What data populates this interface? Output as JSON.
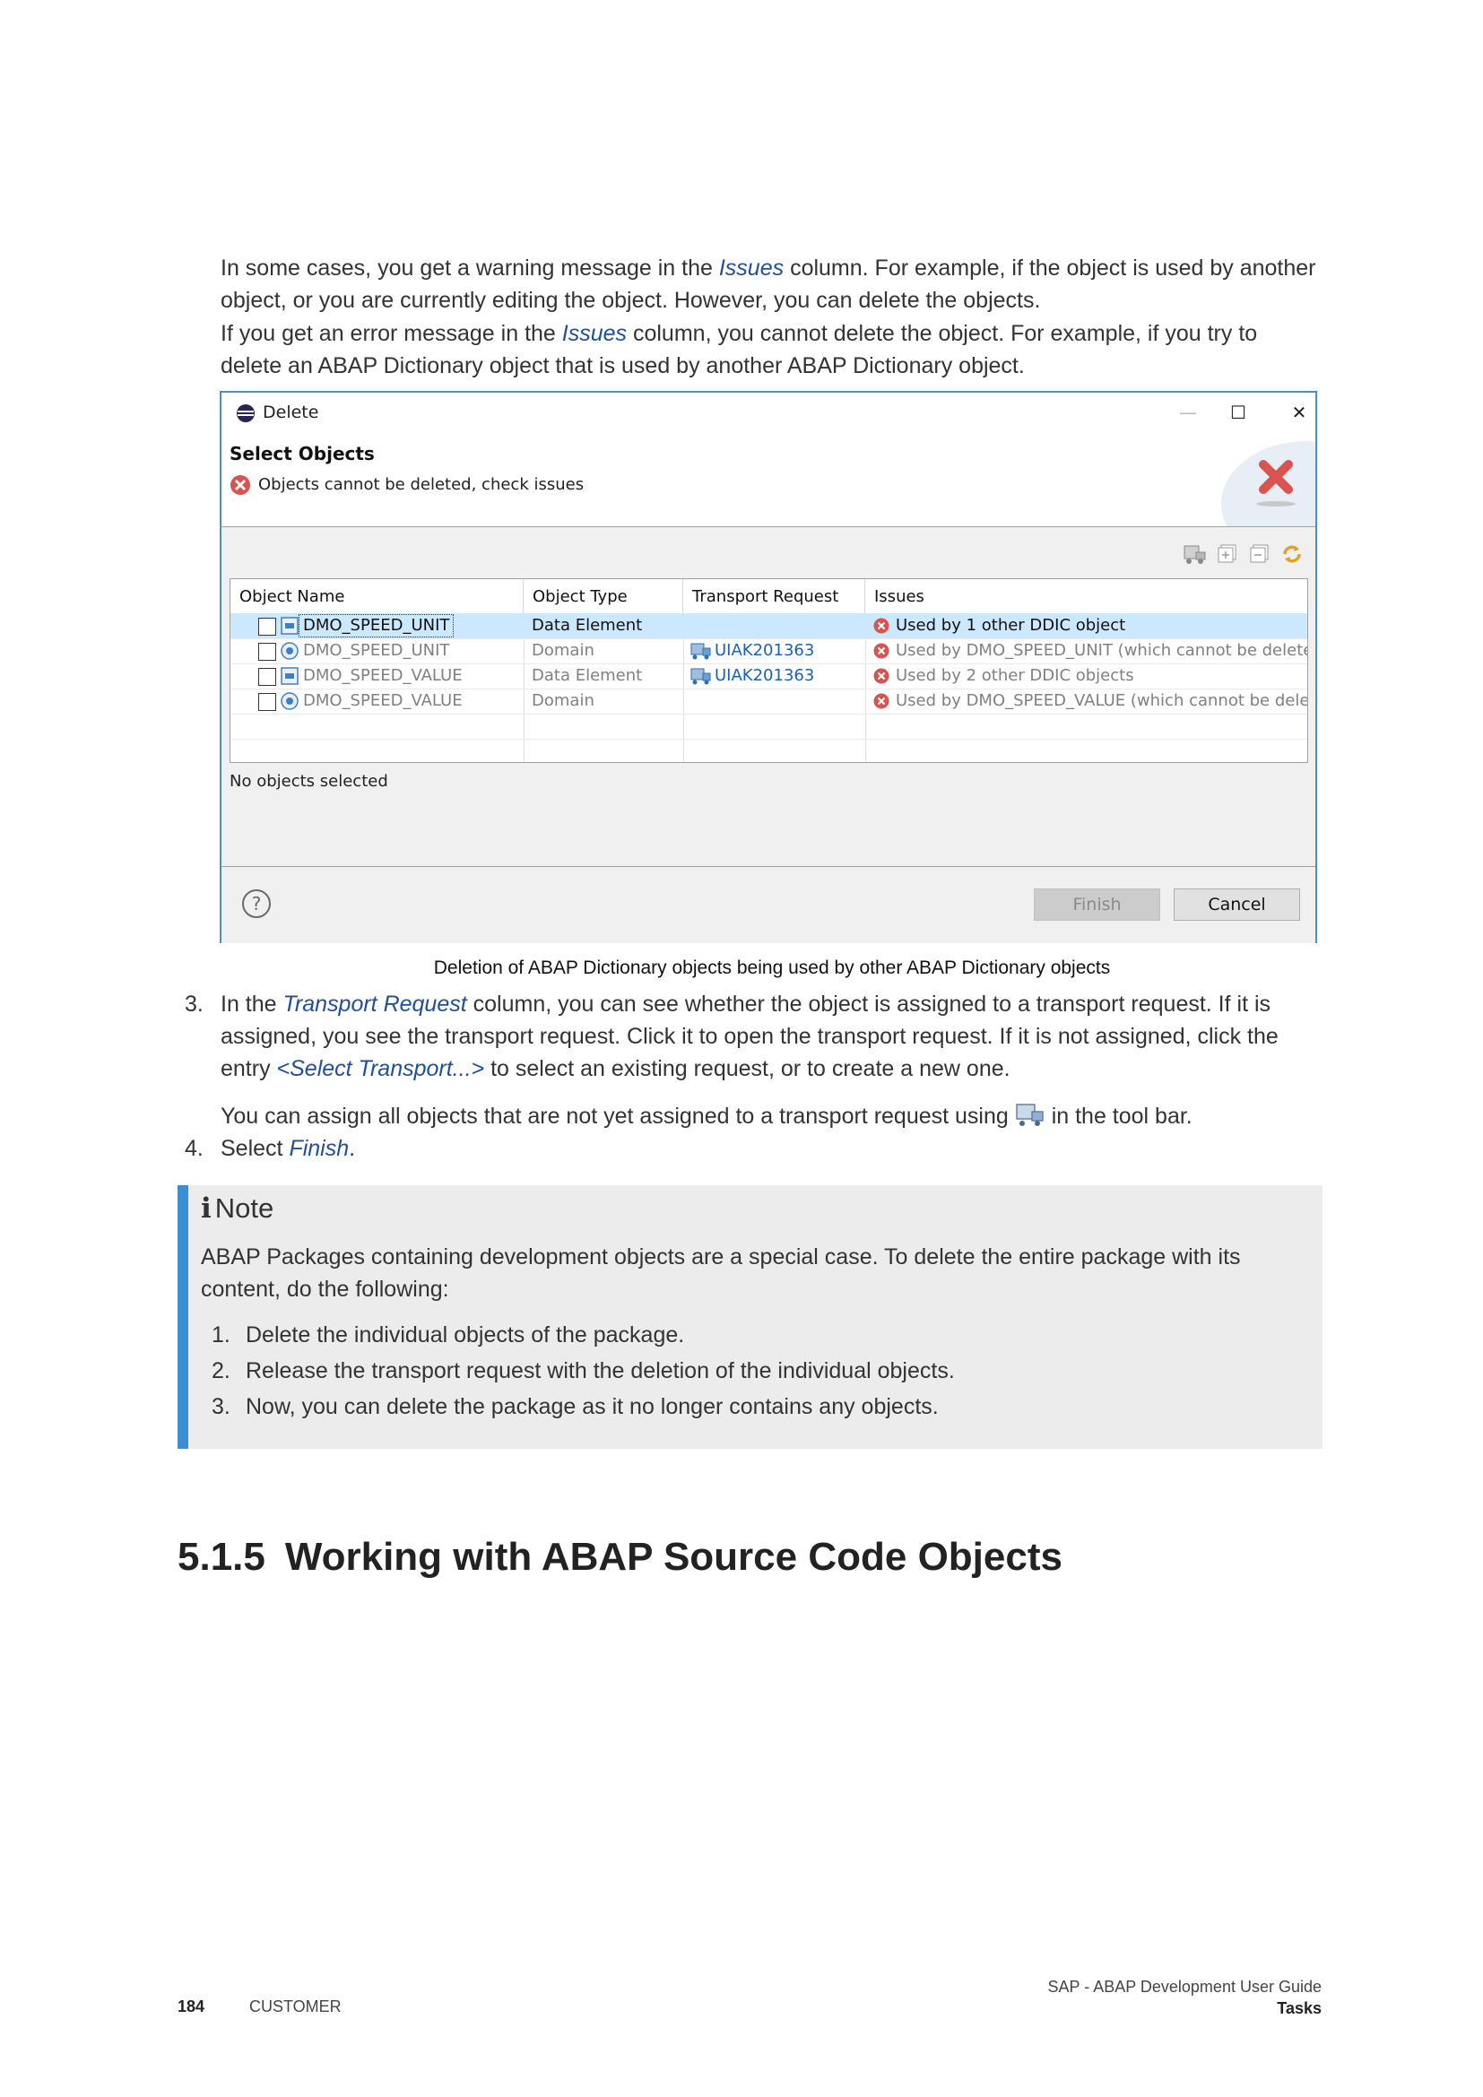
{
  "intro": {
    "line1_pre": "In some cases, you get a warning message in the ",
    "line1_link": "Issues",
    "line1_post": " column. For example, if the object is used by another object, or you are currently editing the object. However, you can delete the objects.",
    "line2_pre": "If you get an error message in the ",
    "line2_link": "Issues",
    "line2_post": " column, you cannot delete the object. For example, if you try to delete an ABAP Dictionary object that is used by another ABAP Dictionary object."
  },
  "dialog": {
    "title": "Delete",
    "minimize": "—",
    "maximize": "☐",
    "close": "✕",
    "header_title": "Select Objects",
    "header_message": "Objects cannot be deleted, check issues",
    "columns": [
      "Object Name",
      "Object Type",
      "Transport Request",
      "Issues"
    ],
    "rows": [
      {
        "name": "DMO_SPEED_UNIT",
        "type": "Data Element",
        "transport": "",
        "issue": "Used by 1 other DDIC object"
      },
      {
        "name": "DMO_SPEED_UNIT",
        "type": "Domain",
        "transport": "UIAK201363",
        "issue": "Used by DMO_SPEED_UNIT (which cannot be deleted)"
      },
      {
        "name": "DMO_SPEED_VALUE",
        "type": "Data Element",
        "transport": "UIAK201363",
        "issue": "Used by 2 other DDIC objects"
      },
      {
        "name": "DMO_SPEED_VALUE",
        "type": "Domain",
        "transport": "",
        "issue": "Used by DMO_SPEED_VALUE (which cannot be deleted)"
      }
    ],
    "status": "No objects selected",
    "finish_label": "Finish",
    "cancel_label": "Cancel"
  },
  "caption": "Deletion of ABAP Dictionary objects being used by other ABAP Dictionary objects",
  "step3": {
    "num": "3.",
    "pre": "In the ",
    "link": "Transport Request",
    "mid": " column, you can see whether the object is assigned to a transport request. If it is assigned, you see the transport request. Click it to open the transport request. If it is not assigned, click the entry ",
    "link2": "<Select Transport...>",
    "post": " to select an existing request, or to create a new one.",
    "extra_pre": "You can assign all objects that are not yet assigned to a transport request using ",
    "extra_post": " in the tool bar."
  },
  "step4": {
    "num": "4.",
    "pre": "Select ",
    "link": "Finish",
    "post": "."
  },
  "note": {
    "icon": "i",
    "title": "Note",
    "text": "ABAP Packages containing development objects are a special case. To delete the entire package with its content, do the following:",
    "items": [
      {
        "num": "1.",
        "text": "Delete the individual objects of the package."
      },
      {
        "num": "2.",
        "text": "Release the transport request with the deletion of the individual objects."
      },
      {
        "num": "3.",
        "text": "Now, you can delete the package as it no longer contains any objects."
      }
    ]
  },
  "section": {
    "number": "5.1.5",
    "title": "Working with ABAP Source Code Objects"
  },
  "footer": {
    "page": "184",
    "classification": "CUSTOMER",
    "doc_title": "SAP - ABAP Development User Guide",
    "chapter": "Tasks"
  }
}
